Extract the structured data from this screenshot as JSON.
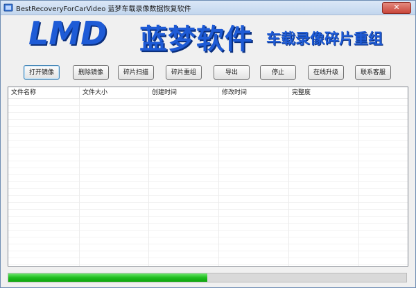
{
  "window": {
    "title": "BestRecoveryForCarVideo   蓝梦车载录像数据恢复软件",
    "close_symbol": "✕"
  },
  "banner": {
    "logo_text": "LMD",
    "brand_name": "蓝梦软件",
    "subtitle": "车载录像碎片重组",
    "brand_color": "#1e5bd6"
  },
  "toolbar": {
    "buttons": [
      {
        "label": "打开镜像"
      },
      {
        "label": "删除镜像"
      },
      {
        "label": "碎片扫描"
      },
      {
        "label": "碎片重组"
      },
      {
        "label": "导出"
      },
      {
        "label": "停止"
      },
      {
        "label": "在线升级"
      },
      {
        "label": "联系客服"
      }
    ]
  },
  "table": {
    "columns": [
      "文件名称",
      "文件大小",
      "创建时间",
      "修改时间",
      "完整度",
      ""
    ],
    "rows": []
  },
  "progress": {
    "value": 0.5,
    "color": "#1fbd1f"
  }
}
